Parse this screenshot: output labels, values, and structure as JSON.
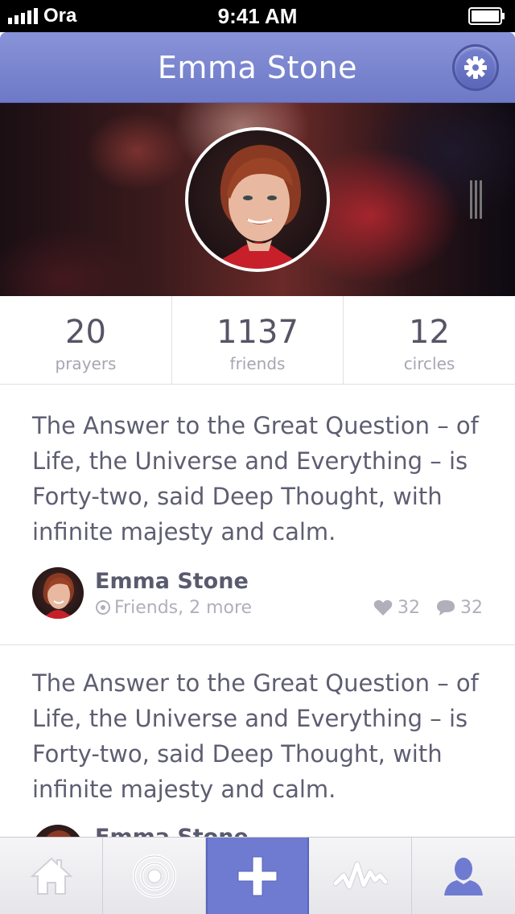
{
  "status_bar": {
    "carrier": "Ora",
    "time": "9:41 AM"
  },
  "nav": {
    "title": "Emma Stone",
    "settings_icon": "gear-icon"
  },
  "stats": [
    {
      "value": "20",
      "label": "prayers"
    },
    {
      "value": "1137",
      "label": "friends"
    },
    {
      "value": "12",
      "label": "circles"
    }
  ],
  "posts": [
    {
      "text": "The Answer to the Great Question – of Life, the Universe and Everything – is Forty-two, said Deep Thought, with infinite majesty and calm.",
      "author": "Emma Stone",
      "audience": "Friends, 2 more",
      "likes": "32",
      "comments": "32"
    },
    {
      "text": "The Answer to the Great Question – of Life, the Universe and Everything – is Forty-two, said Deep Thought, with infinite majesty and calm.",
      "author": "Emma Stone"
    }
  ],
  "tab_bar": {
    "tabs": [
      {
        "icon": "home-icon"
      },
      {
        "icon": "target-icon"
      },
      {
        "icon": "plus-icon",
        "active": true
      },
      {
        "icon": "activity-icon"
      },
      {
        "icon": "profile-icon"
      }
    ]
  },
  "colors": {
    "accent": "#6f7bd0",
    "nav_gradient_top": "#8893d8",
    "text": "#5e5e72",
    "muted": "#b0b0bc"
  }
}
